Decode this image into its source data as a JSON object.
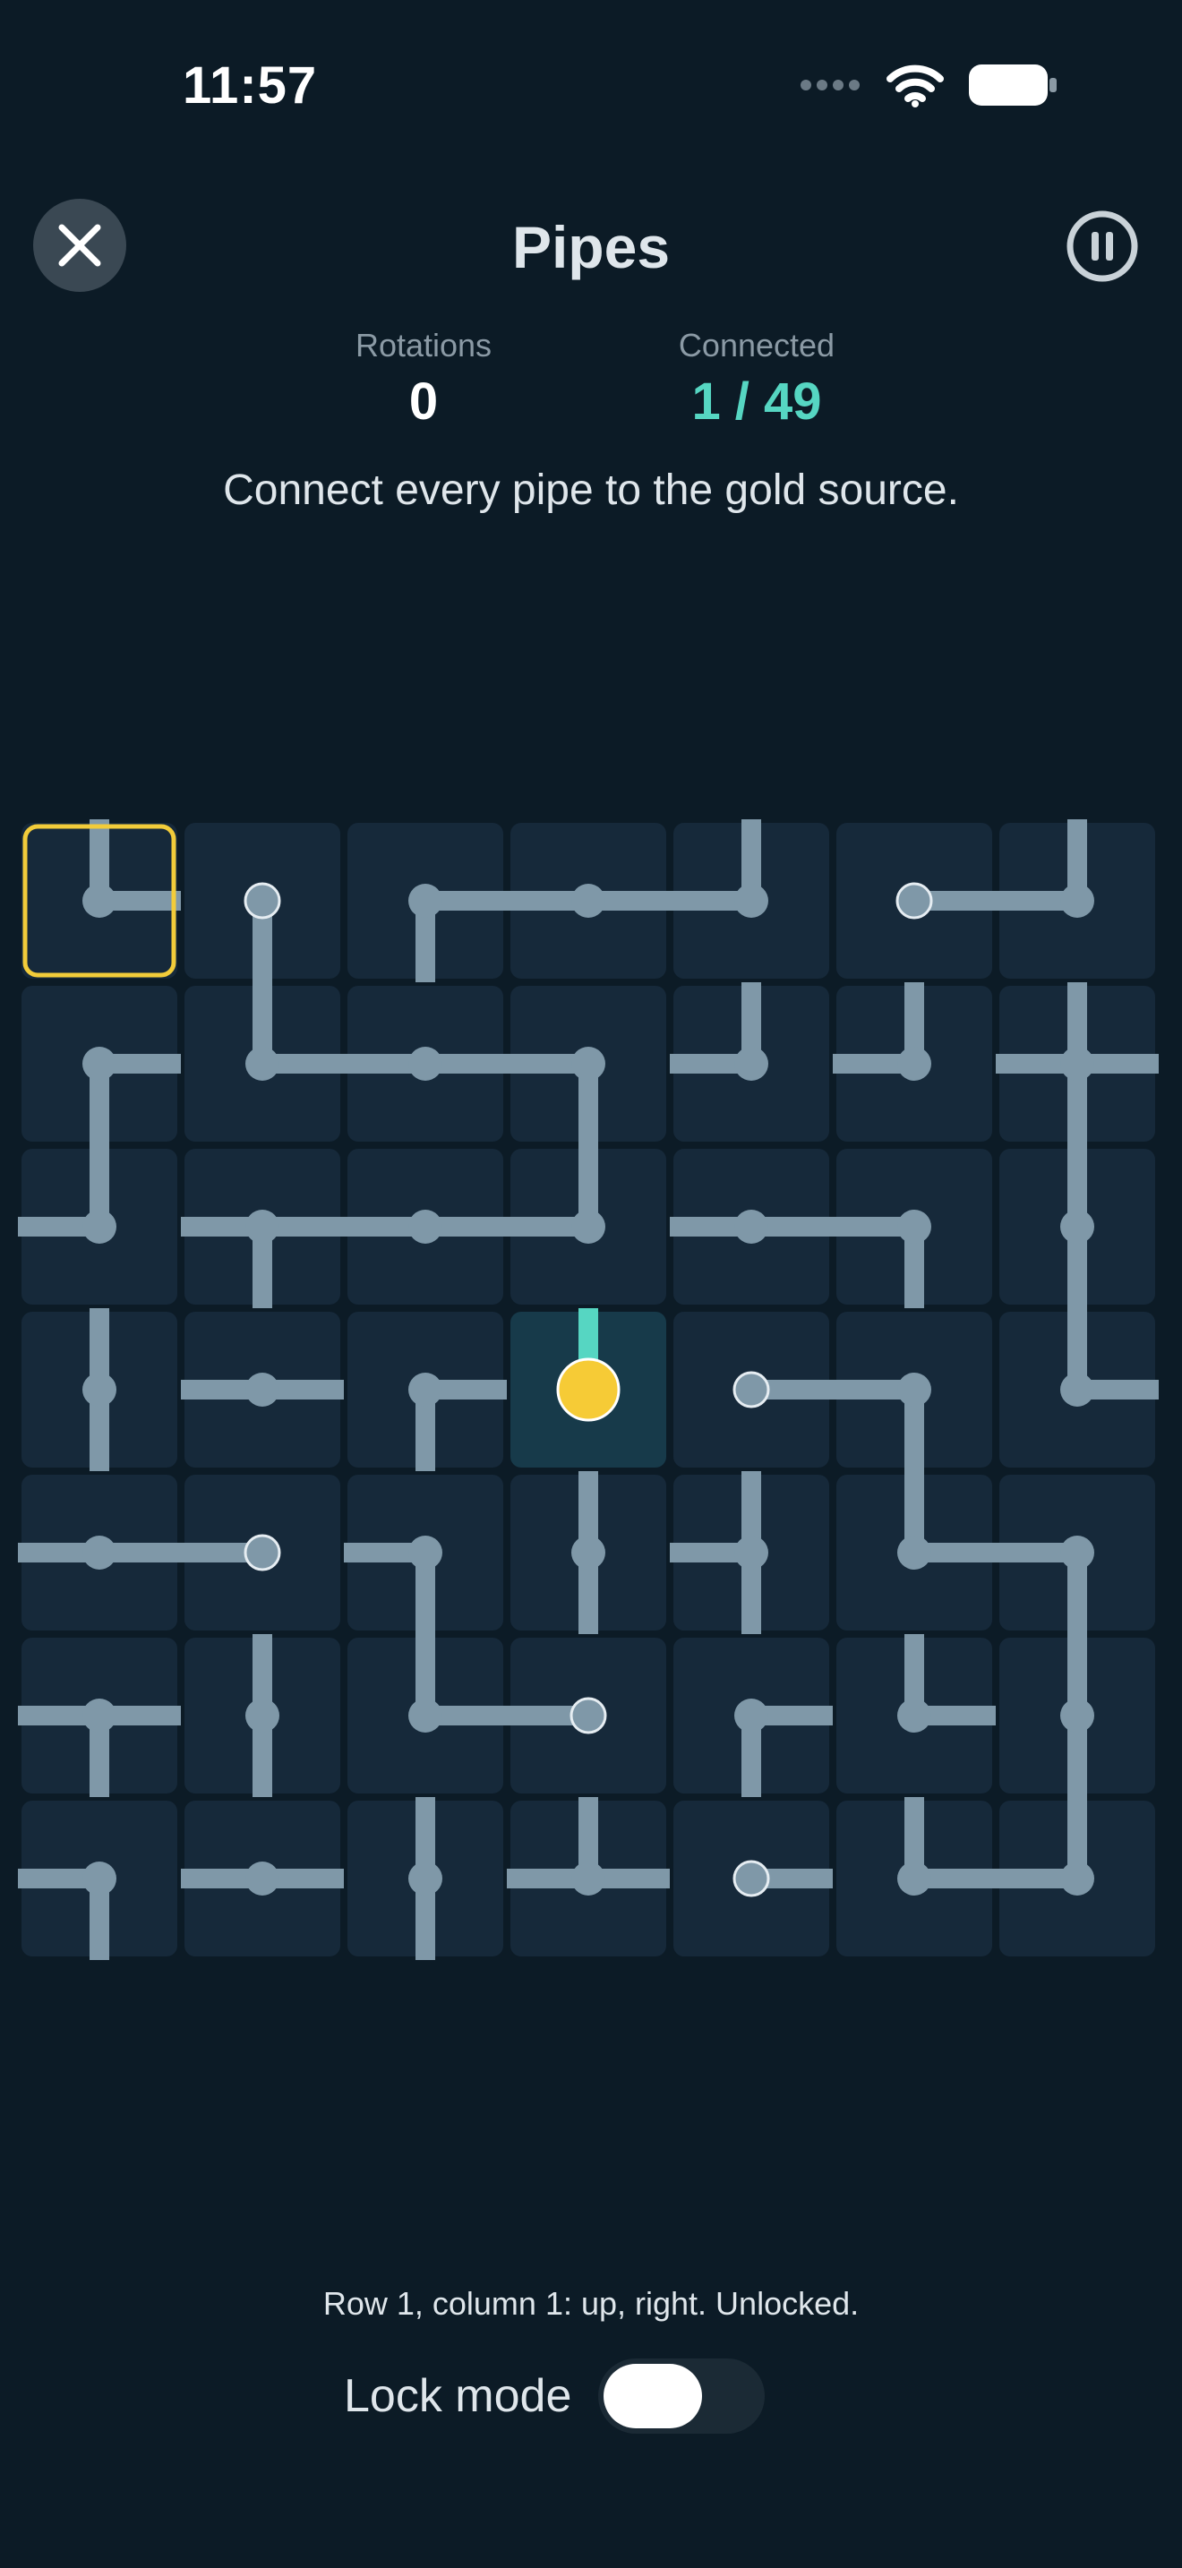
{
  "status_bar": {
    "time": "11:57",
    "icons": [
      "signal-dots-icon",
      "wifi-icon",
      "battery-icon"
    ]
  },
  "header": {
    "title": "Pipes",
    "close_icon": "close-icon",
    "pause_icon": "pause-icon"
  },
  "stats": {
    "rotations_label": "Rotations",
    "rotations_value": "0",
    "connected_label": "Connected",
    "connected_value": "1 / 49"
  },
  "hint": "Connect every pipe to the gold source.",
  "board": {
    "rows": 7,
    "cols": 7,
    "selected": [
      0,
      0
    ],
    "source": [
      3,
      3
    ],
    "colors": {
      "tile": "#16293a",
      "tile_source": "#173a4a",
      "pipe": "#7f98a8",
      "pipe_connected": "#56d6c2",
      "source": "#f6cb36",
      "selection": "#f2cc3a"
    },
    "cells": [
      [
        "ur",
        "d",
        "rd",
        "lr",
        "ul",
        "r",
        "ul"
      ],
      [
        "rd",
        "ur",
        "lr",
        "ld",
        "ul",
        "ul",
        "udlr"
      ],
      [
        "ul",
        "ldr",
        "lr",
        "ul",
        "lr",
        "dl",
        "ud"
      ],
      [
        "ud",
        "lr",
        "rd",
        "u",
        "r",
        "ld",
        "ur"
      ],
      [
        "lr",
        "l",
        "ld",
        "ud",
        "udl",
        "ur",
        "ld"
      ],
      [
        "ldr",
        "ud",
        "ur",
        "l",
        "rd",
        "ur",
        "ud"
      ],
      [
        "ld",
        "lr",
        "ud",
        "ulr",
        "r",
        "ur",
        "ul"
      ]
    ]
  },
  "footer": {
    "status_text": "Row 1, column 1: up, right. Unlocked.",
    "lock_label": "Lock mode",
    "lock_enabled": false
  }
}
